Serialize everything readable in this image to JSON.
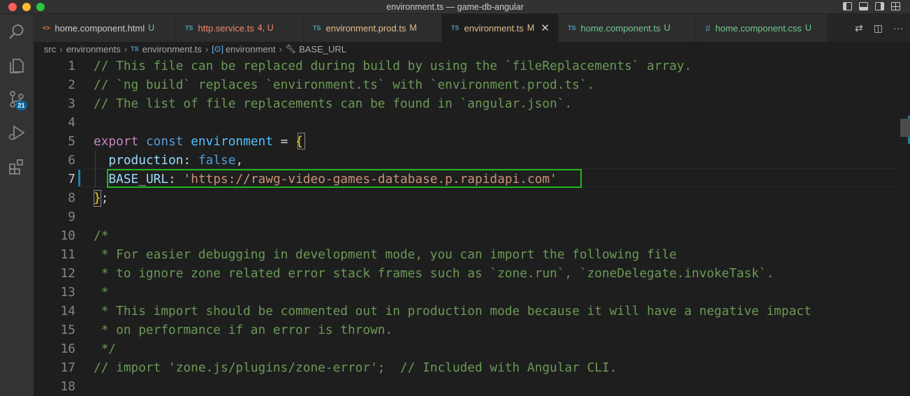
{
  "window": {
    "title": "environment.ts — game-db-angular"
  },
  "activity": {
    "scm_badge": "21"
  },
  "tabs": [
    {
      "icon": "<>",
      "name": "home.component.html",
      "status": "U",
      "icon_color": "#e37933",
      "status_color": "#73c991",
      "name_color": "#cccccc"
    },
    {
      "icon": "TS",
      "name": "http.service.ts",
      "status": "4, U",
      "icon_color": "#519aba",
      "status_color": "#f48771",
      "name_color": "#f48771"
    },
    {
      "icon": "TS",
      "name": "environment.prod.ts",
      "status": "M",
      "icon_color": "#519aba",
      "status_color": "#e2c08d",
      "name_color": "#e2c08d"
    },
    {
      "icon": "TS",
      "name": "environment.ts",
      "status": "M",
      "icon_color": "#519aba",
      "status_color": "#e2c08d",
      "name_color": "#e2c08d",
      "close": "✕"
    },
    {
      "icon": "TS",
      "name": "home.component.ts",
      "status": "U",
      "icon_color": "#519aba",
      "status_color": "#73c991",
      "name_color": "#73c991"
    },
    {
      "icon": "#",
      "name": "home.component.css",
      "status": "U",
      "icon_color": "#519aba",
      "status_color": "#73c991",
      "name_color": "#73c991"
    }
  ],
  "breadcrumbs": {
    "src": "src",
    "folder": "environments",
    "file_icon": "TS",
    "file": "environment.ts",
    "symbol": "environment",
    "property": "BASE_URL"
  },
  "editor": {
    "current_line": 7,
    "lines": [
      {
        "n": "1",
        "tokens": [
          {
            "c": "c-comment",
            "t": "// This file can be replaced during build by using the `fileReplacements` array."
          }
        ]
      },
      {
        "n": "2",
        "tokens": [
          {
            "c": "c-comment",
            "t": "// `ng build` replaces `environment.ts` with `environment.prod.ts`."
          }
        ]
      },
      {
        "n": "3",
        "tokens": [
          {
            "c": "c-comment",
            "t": "// The list of file replacements can be found in `angular.json`."
          }
        ]
      },
      {
        "n": "4",
        "tokens": []
      },
      {
        "n": "5",
        "tokens": [
          {
            "c": "c-kw",
            "t": "export"
          },
          {
            "c": "c-op",
            "t": " "
          },
          {
            "c": "c-storage",
            "t": "const"
          },
          {
            "c": "c-op",
            "t": " "
          },
          {
            "c": "c-var",
            "t": "environment"
          },
          {
            "c": "c-op",
            "t": " = "
          },
          {
            "c": "c-brace",
            "t": "{"
          }
        ]
      },
      {
        "n": "6",
        "tokens": [
          {
            "c": "c-op",
            "t": "  "
          },
          {
            "c": "c-prop",
            "t": "production"
          },
          {
            "c": "c-op",
            "t": ": "
          },
          {
            "c": "c-storage",
            "t": "false"
          },
          {
            "c": "c-op",
            "t": ","
          }
        ]
      },
      {
        "n": "7",
        "tokens": [
          {
            "c": "c-op",
            "t": "  "
          },
          {
            "c": "c-prop",
            "t": "BASE_URL"
          },
          {
            "c": "c-op",
            "t": ": "
          },
          {
            "c": "c-str",
            "t": "'https://rawg-video-games-database.p.rapidapi.com'"
          }
        ]
      },
      {
        "n": "8",
        "tokens": [
          {
            "c": "c-brace",
            "t": "}"
          },
          {
            "c": "c-op",
            "t": ";"
          }
        ]
      },
      {
        "n": "9",
        "tokens": []
      },
      {
        "n": "10",
        "tokens": [
          {
            "c": "c-comment",
            "t": "/*"
          }
        ]
      },
      {
        "n": "11",
        "tokens": [
          {
            "c": "c-comment",
            "t": " * For easier debugging in development mode, you can import the following file"
          }
        ]
      },
      {
        "n": "12",
        "tokens": [
          {
            "c": "c-comment",
            "t": " * to ignore zone related error stack frames such as `zone.run`, `zoneDelegate.invokeTask`."
          }
        ]
      },
      {
        "n": "13",
        "tokens": [
          {
            "c": "c-comment",
            "t": " *"
          }
        ]
      },
      {
        "n": "14",
        "tokens": [
          {
            "c": "c-comment",
            "t": " * This import should be commented out in production mode because it will have a negative impact"
          }
        ]
      },
      {
        "n": "15",
        "tokens": [
          {
            "c": "c-comment",
            "t": " * on performance if an error is thrown."
          }
        ]
      },
      {
        "n": "16",
        "tokens": [
          {
            "c": "c-comment",
            "t": " */"
          }
        ]
      },
      {
        "n": "17",
        "tokens": [
          {
            "c": "c-comment",
            "t": "// import 'zone.js/plugins/zone-error';  // Included with Angular CLI."
          }
        ]
      },
      {
        "n": "18",
        "tokens": []
      }
    ]
  }
}
